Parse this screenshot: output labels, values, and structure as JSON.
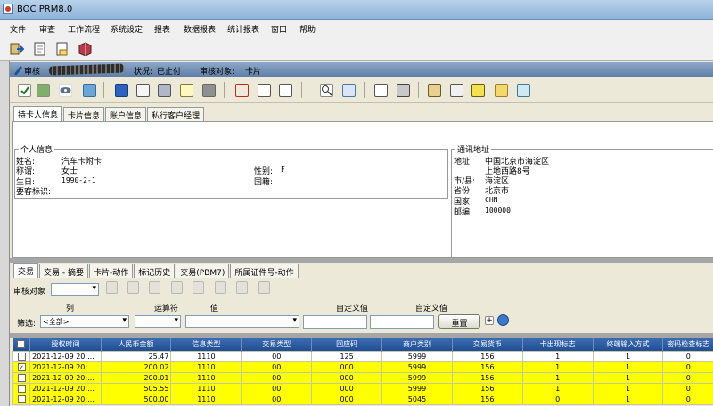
{
  "window": {
    "title": "BOC PRM8.0"
  },
  "menu": [
    "文件",
    "审查",
    "工作流程",
    "系统设定",
    "报表",
    "数据报表",
    "统计报表",
    "窗口",
    "帮助"
  ],
  "record": {
    "prefix": "审核",
    "status_label": "状况:",
    "status_value": "已止付",
    "target_label": "审核对象:",
    "target_value": "卡片"
  },
  "card_tabs": [
    "持卡人信息",
    "卡片信息",
    "账户信息",
    "私行客户经理"
  ],
  "personal": {
    "legend": "个人信息",
    "name_label": "姓名:",
    "name": "汽车卡附卡",
    "title_label": "称谓:",
    "title": "女士",
    "gender_label": "性别:",
    "gender": "F",
    "birth_label": "生日:",
    "birth": "1990-2-1",
    "nationality_label": "国籍:",
    "vip_label": "要客标识:"
  },
  "address": {
    "legend": "通讯地址",
    "addr_label": "地址:",
    "addr1": "中国北京市海淀区",
    "addr2": "上地西路8号",
    "city_label": "市/县:",
    "city": "海淀区",
    "prov_label": "省份:",
    "prov": "北京市",
    "country_label": "国家:",
    "country": "CHN",
    "zip_label": "邮编:",
    "zip": "100000"
  },
  "txn_tabs": [
    "交易",
    "交易 - 摘要",
    "卡片-动作",
    "标记历史",
    "交易(PBM7)",
    "所属证件号-动作"
  ],
  "filter": {
    "target_label": "审核对象",
    "col_label": "列",
    "op_label": "运算符",
    "val_label": "值",
    "custom1": "自定义值",
    "custom2": "自定义值",
    "filter_label": "筛选:",
    "col_value": "<全部>",
    "reset": "重置"
  },
  "table": {
    "headers": [
      "授权时间",
      "人民币金额",
      "信息类型",
      "交易类型",
      "回应码",
      "商户类别",
      "交易货币",
      "卡出现标志",
      "终端输入方式",
      "密码检查标志"
    ],
    "rows": [
      {
        "checked": false,
        "hl": false,
        "cells": [
          "2021-12-09 20:...",
          "25.47",
          "1110",
          "00",
          "125",
          "5999",
          "156",
          "1",
          "1",
          "0"
        ]
      },
      {
        "checked": true,
        "hl": true,
        "cells": [
          "2021-12-09 20:...",
          "200.02",
          "1110",
          "00",
          "000",
          "5999",
          "156",
          "1",
          "1",
          "0"
        ]
      },
      {
        "checked": false,
        "hl": true,
        "cells": [
          "2021-12-09 20:...",
          "200.01",
          "1110",
          "00",
          "000",
          "5999",
          "156",
          "1",
          "1",
          "0"
        ]
      },
      {
        "checked": false,
        "hl": true,
        "cells": [
          "2021-12-09 20:...",
          "505.55",
          "1110",
          "00",
          "000",
          "5999",
          "156",
          "1",
          "1",
          "0"
        ]
      },
      {
        "checked": false,
        "hl": true,
        "cells": [
          "2021-12-09 20:...",
          "500.00",
          "1110",
          "00",
          "000",
          "5045",
          "156",
          "0",
          "1",
          "0"
        ]
      }
    ]
  },
  "colors": {
    "highlight": "#ffff00",
    "header": "#2a5ba0",
    "title": "#a9c7e6"
  }
}
